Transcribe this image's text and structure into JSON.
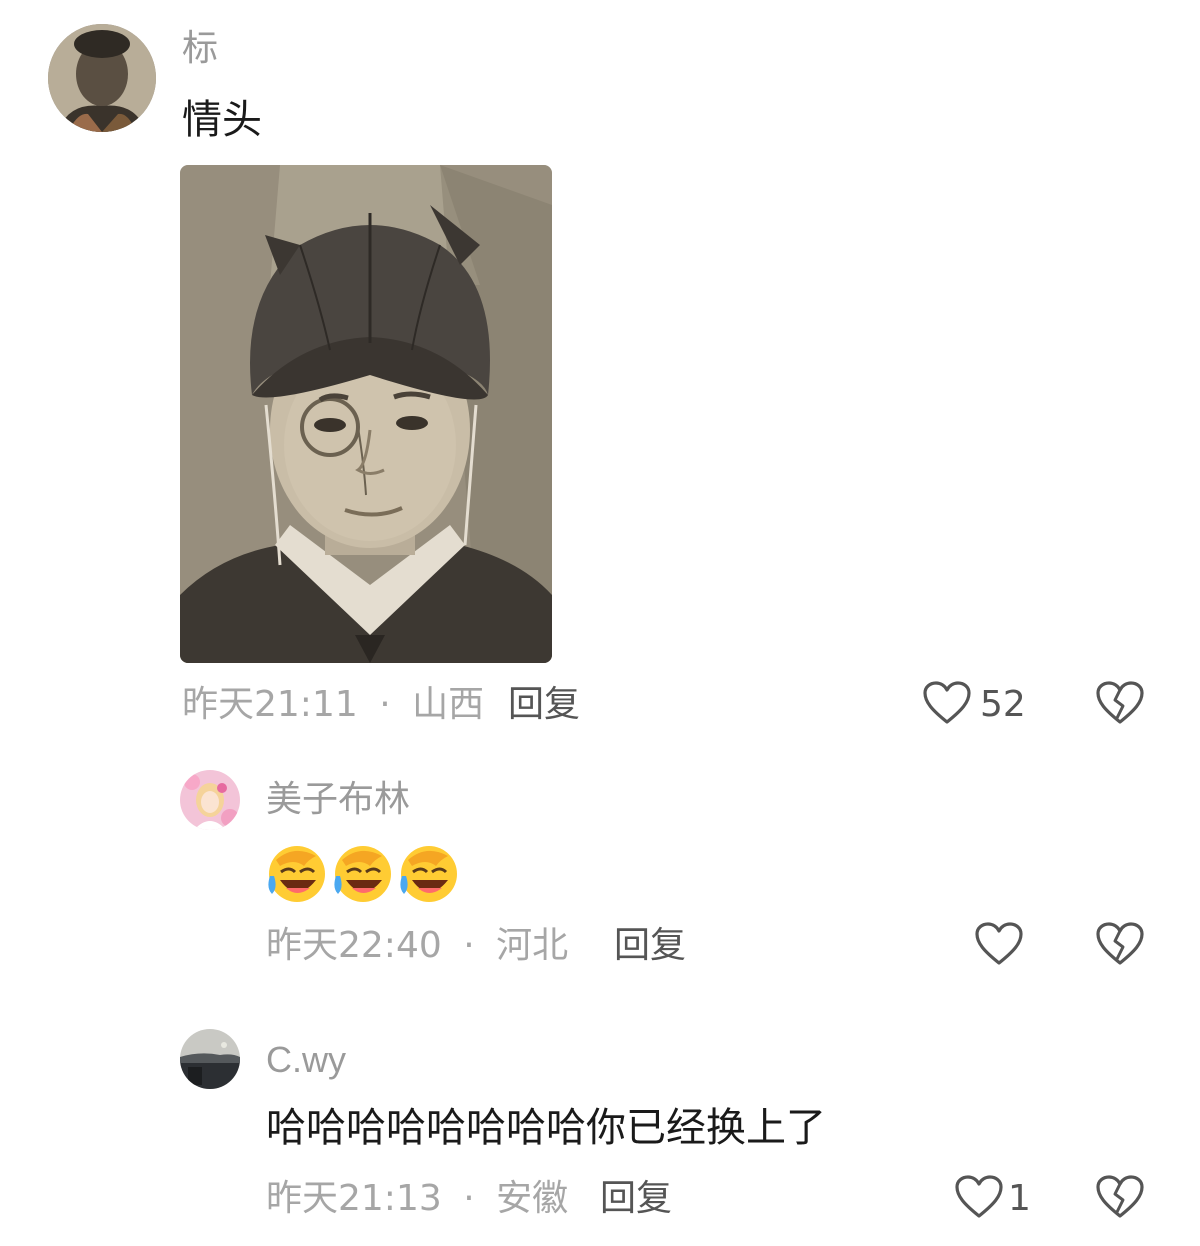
{
  "comments": [
    {
      "username": "标",
      "text": "情头",
      "time": "昨天21:11",
      "location": "山西",
      "reply_label": "回复",
      "like_count": "52"
    },
    {
      "username": "美子布林",
      "time": "昨天22:40",
      "location": "河北",
      "reply_label": "回复",
      "like_count": ""
    },
    {
      "username": "C.wy",
      "text": "哈哈哈哈哈哈哈哈你已经换上了",
      "time": "昨天21:13",
      "location": "安徽",
      "reply_label": "回复",
      "like_count": "1"
    }
  ],
  "separator": "·",
  "icons": {
    "like": "heart-outline-icon",
    "dislike": "broken-heart-icon",
    "emoji": "rolling-on-floor-laughing-emoji"
  },
  "colors": {
    "username": "#9a9a9a",
    "text": "#1a1a1a",
    "meta": "#a6a6a6",
    "icon": "#555555"
  }
}
